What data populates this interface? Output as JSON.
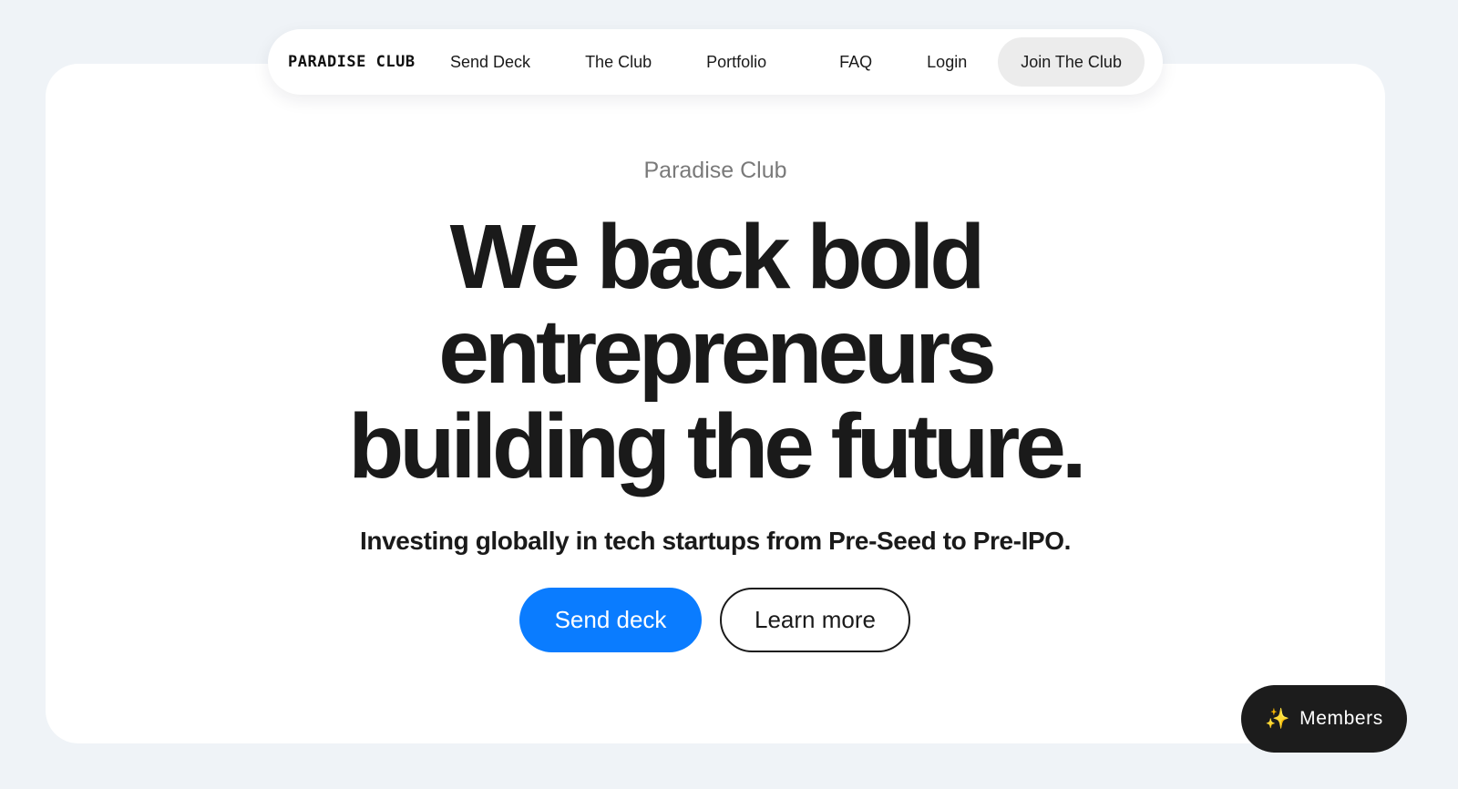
{
  "nav": {
    "logo": "PARADISE CLUB",
    "links": [
      "Send Deck",
      "The Club",
      "Portfolio",
      "FAQ",
      "Login"
    ],
    "cta": "Join The Club"
  },
  "hero": {
    "eyebrow": "Paradise Club",
    "headline_lines": [
      "We back bold",
      "entrepreneurs",
      "building the future."
    ],
    "subhead": "Investing globally in tech startups from Pre-Seed to Pre-IPO.",
    "primary_button": "Send deck",
    "secondary_button": "Learn more"
  },
  "floating": {
    "members_label": "Members",
    "members_icon": "sparkle-icon"
  },
  "colors": {
    "background": "#eff3f7",
    "card": "#ffffff",
    "accent_blue": "#0a7cff",
    "dark_pill": "#1c1c1c",
    "sparkle": "#f3a93b"
  }
}
